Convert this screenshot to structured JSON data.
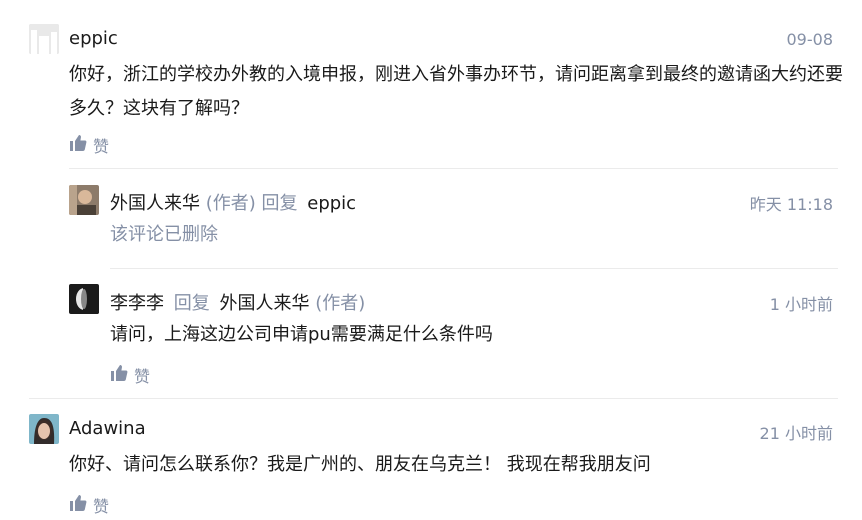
{
  "comments": [
    {
      "author": "eppic",
      "time": "09-08",
      "text": "你好，浙江的学校办外教的入境申报，刚进入省外事办环节，请问距离拿到最终的邀请函大约还要多久？这块有了解吗？",
      "like_label": "赞",
      "replies": [
        {
          "author": "外国人来华",
          "author_tag": "(作者)",
          "reply_word": "回复",
          "reply_to": "eppic",
          "time": "昨天 11:18",
          "text": "该评论已删除"
        },
        {
          "author": "李李李",
          "reply_word": "回复",
          "reply_to": "外国人来华",
          "reply_to_tag": "(作者)",
          "time": "1 小时前",
          "text": "请问，上海这边公司申请pu需要满足什么条件吗",
          "like_label": "赞"
        }
      ]
    },
    {
      "author": "Adawina",
      "time": "21 小时前",
      "text": "你好、请问怎么联系你？我是广州的、朋友在乌克兰！ 我现在帮我朋友问",
      "like_label": "赞"
    }
  ],
  "icons": {
    "like": "thumbs-up-icon"
  }
}
